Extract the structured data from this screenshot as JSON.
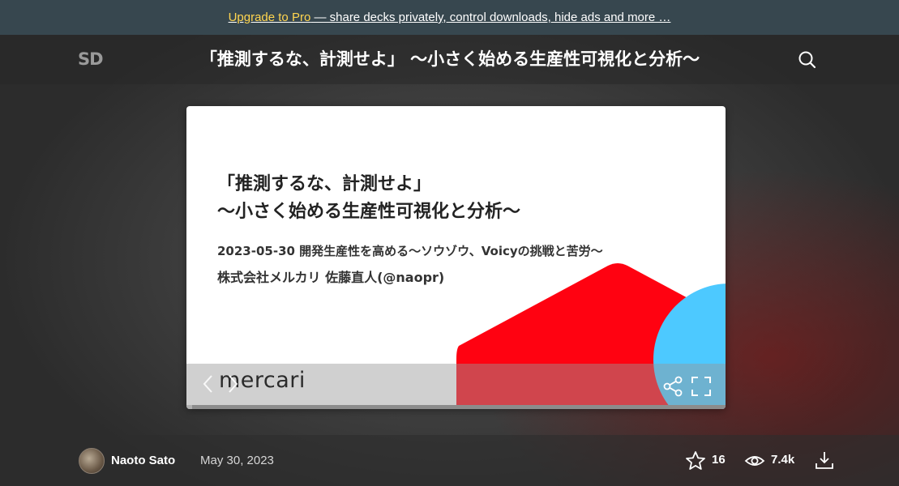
{
  "promo": {
    "pro_link": "Upgrade to Pro",
    "rest": " — share decks privately, control downloads, hide ads and more …"
  },
  "header": {
    "logo": "SD",
    "title": "「推測するな、計測せよ」 〜小さく始める生産性可視化と分析〜"
  },
  "slide": {
    "heading_line1": "「推測するな、計測せよ」",
    "heading_line2": "〜小さく始める生産性可視化と分析〜",
    "sub_line1": "2023-05-30 開発生産性を高める〜ソウゾウ、Voicyの挑戦と苦労〜",
    "sub_line2": "株式会社メルカリ 佐藤直人(@naopr)",
    "brand": "mercari",
    "progress": 0.01,
    "colors": {
      "red": "#ff0211",
      "blue": "#4dc9ff"
    }
  },
  "footer": {
    "author": "Naoto Sato",
    "date": "May 30, 2023",
    "stars": "16",
    "views": "7.4k"
  },
  "icons": [
    "search-icon",
    "chevron-left-icon",
    "chevron-right-icon",
    "share-icon",
    "fullscreen-icon",
    "star-icon",
    "eye-icon",
    "download-icon"
  ]
}
